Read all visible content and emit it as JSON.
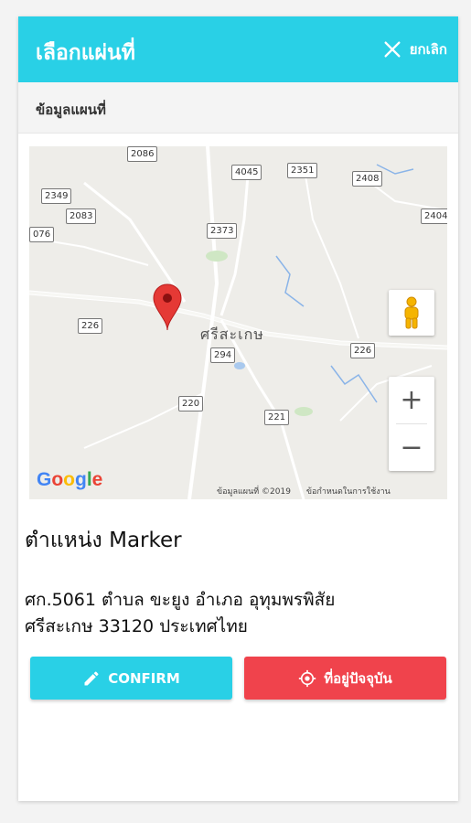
{
  "header": {
    "title": "เลือกแผ่นที่",
    "cancel_label": "ยกเลิก"
  },
  "subheader": {
    "label": "ข้อมูลแผนที่"
  },
  "map": {
    "road_labels": [
      "2086",
      "4045",
      "2351",
      "2408",
      "2349",
      "2083",
      "076",
      "2373",
      "2404",
      "226",
      "294",
      "226",
      "220",
      "221"
    ],
    "town_label": "ศรีสะเกษ",
    "google_logo": "Google",
    "attribution": "ข้อมูลแผนที่ ©2019",
    "terms": "ข้อกำหนดในการใช้งาน",
    "zoom_in": "+",
    "zoom_out": "−"
  },
  "position_title": "ตำแหน่ง Marker",
  "address": {
    "line1": "ศก.5061 ตำบล ขะยูง อำเภอ อุทุมพรพิสัย",
    "line2": "ศรีสะเกษ 33120 ประเทศไทย"
  },
  "buttons": {
    "confirm": "CONFIRM",
    "current_location": "ที่อยู่ปัจจุบัน"
  },
  "colors": {
    "primary": "#29d0e6",
    "danger": "#f0434c",
    "marker": "#e53935"
  }
}
